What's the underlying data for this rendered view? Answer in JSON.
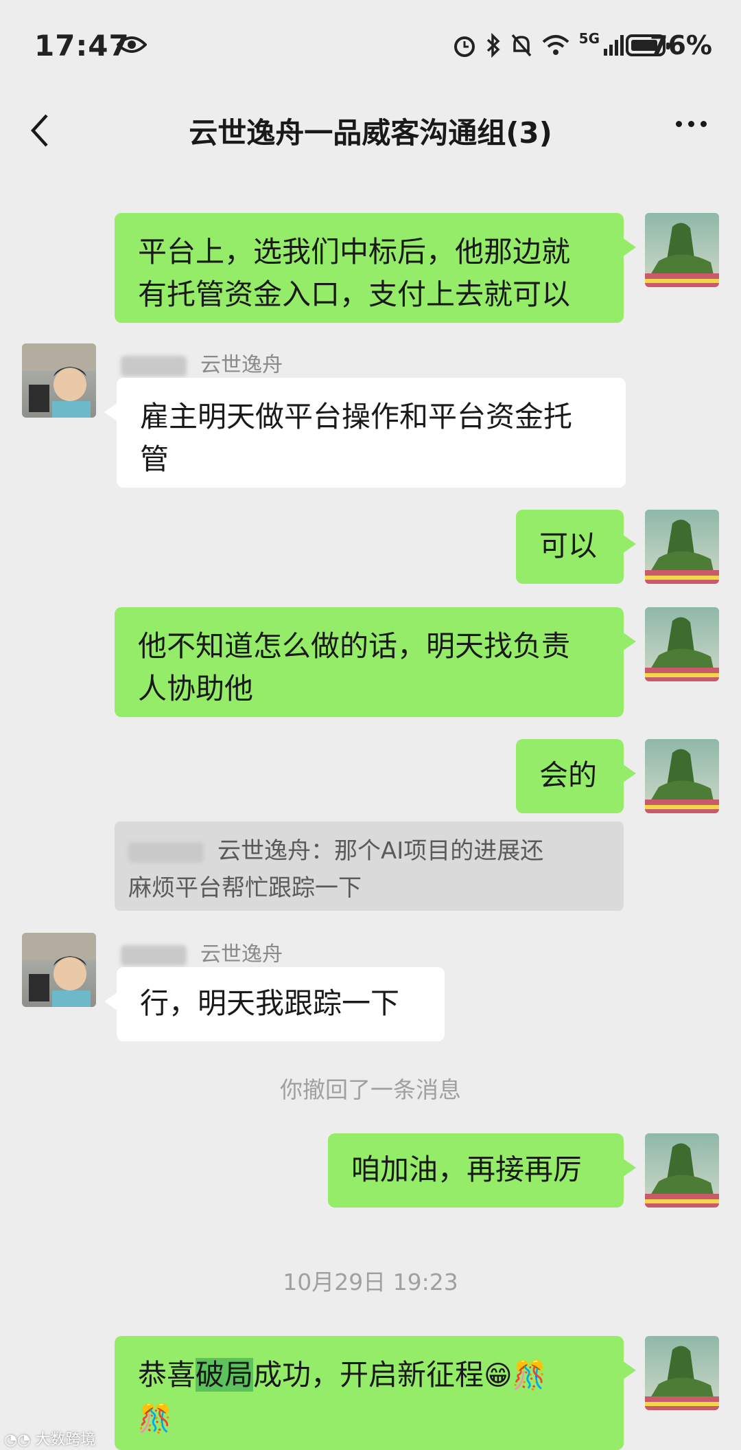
{
  "status_bar": {
    "time": "17:47",
    "network": "5G",
    "battery_percent": "76%"
  },
  "header": {
    "title": "云世逸舟一品威客沟通组(3)"
  },
  "messages": {
    "m1": {
      "line1": "平台上，选我们中标后，他那边就",
      "line2": "有托管资金入口，支付上去就可以"
    },
    "m2": {
      "sender": "云世逸舟",
      "line1": "雇主明天做平台操作和平台资金托",
      "line2": "管"
    },
    "m3": {
      "text": "可以"
    },
    "m4": {
      "line1": "他不知道怎么做的话，明天找负责",
      "line2": "人协助他"
    },
    "m5": {
      "text": "会的"
    },
    "quote": {
      "line1": "云世逸舟：那个AI项目的进展还",
      "line2": "麻烦平台帮忙跟踪一下"
    },
    "m6": {
      "sender": "云世逸舟",
      "text": "行，明天我跟踪一下"
    },
    "recall_notice": "你撤回了一条消息",
    "m7": {
      "text": "咱加油，再接再厉"
    },
    "timestamp": "10月29日 19:23",
    "m8": {
      "part1": "恭喜",
      "highlight": "破局",
      "part2": "成功，开启新征程",
      "emoji1": "😁🎊",
      "emoji2": "🎊"
    }
  },
  "watermark": "大数跨境",
  "colors": {
    "background": "#ededed",
    "sent_bubble": "#95ec69",
    "received_bubble": "#ffffff"
  }
}
